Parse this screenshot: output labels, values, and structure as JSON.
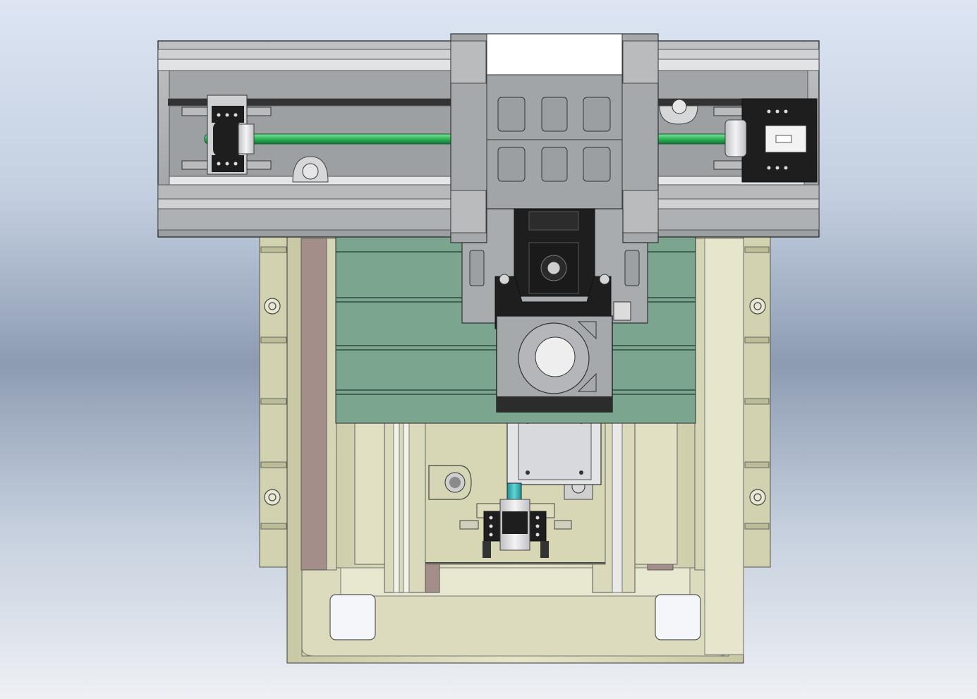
{
  "view": {
    "title": "",
    "background_top": "#dde5f3",
    "background_mid": "#8d9bb2",
    "background_bottom": "#eef0f4"
  },
  "model": {
    "colors": {
      "aluminum": "#a9acae",
      "aluminum_light": "#d4d6d8",
      "base_khaki": "#d9d8b8",
      "base_khaki_dark": "#b9b890",
      "table_green": "#7ca58f",
      "leadscrew_green": "#2fb457",
      "coupling_teal": "#3bb7b9",
      "motor_black": "#1e1e1e",
      "rail_rose": "#a48e8a",
      "plate_silver": "#c9cbcd"
    },
    "icons": {
      "x_axis_screw": "leadscrew-icon",
      "motor": "stepper-motor-icon",
      "spindle": "spindle-icon",
      "bearing": "bearing-icon"
    }
  }
}
